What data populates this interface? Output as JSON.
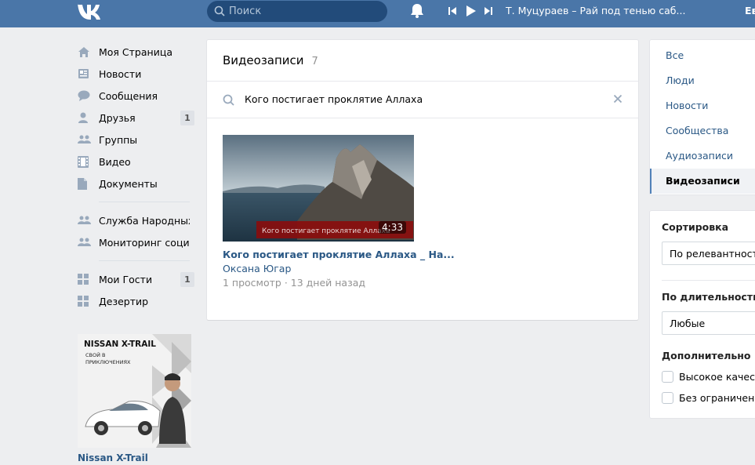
{
  "header": {
    "search_placeholder": "Поиск",
    "now_playing": "Т. Муцураев – Рай под тенью саб...",
    "user_initial": "Ев"
  },
  "nav": {
    "items": [
      {
        "label": "Моя Страница",
        "icon": "home-icon"
      },
      {
        "label": "Новости",
        "icon": "news-icon"
      },
      {
        "label": "Сообщения",
        "icon": "messages-icon"
      },
      {
        "label": "Друзья",
        "icon": "friends-icon",
        "badge": "1"
      },
      {
        "label": "Группы",
        "icon": "groups-icon"
      },
      {
        "label": "Видео",
        "icon": "video-icon"
      },
      {
        "label": "Документы",
        "icon": "documents-icon"
      }
    ],
    "group_links": [
      {
        "label": "Служба Народных..",
        "icon": "community-icon"
      },
      {
        "label": "Мониторинг соци..",
        "icon": "community-icon"
      }
    ],
    "app_links": [
      {
        "label": "Мои Гости",
        "icon": "apps-icon",
        "badge": "1"
      },
      {
        "label": "Дезертир",
        "icon": "apps-icon"
      }
    ]
  },
  "ad": {
    "brand": "NISSAN X-TRAIL",
    "slogan_line1": "СВОЙ В",
    "slogan_line2": "ПРИКЛЮЧЕНИЯХ",
    "title": "Nissan X-Trail"
  },
  "main": {
    "title": "Видеозаписи",
    "count": "7",
    "query": "Кого постигает проклятие Аллаха",
    "video": {
      "overlay_text": "Кого постигает проклятие Аллаха",
      "duration": "4:33",
      "title": "Кого постигает проклятие Аллаха _ На...",
      "author": "Оксана Югар",
      "meta": "1 просмотр · 13 дней назад"
    }
  },
  "tabs": [
    "Все",
    "Люди",
    "Новости",
    "Сообщества",
    "Аудиозаписи",
    "Видеозаписи"
  ],
  "active_tab": "Видеозаписи",
  "filters": {
    "sort_label": "Сортировка",
    "sort_value": "По релевантности",
    "duration_label": "По длительности",
    "duration_value": "Любые",
    "extra_label": "Дополнительно",
    "checkbox_hd": "Высокое качество",
    "checkbox_safe": "Без ограничений"
  },
  "colors": {
    "header": "#4a76a8",
    "link": "#2a5885",
    "background": "#edeef0"
  }
}
